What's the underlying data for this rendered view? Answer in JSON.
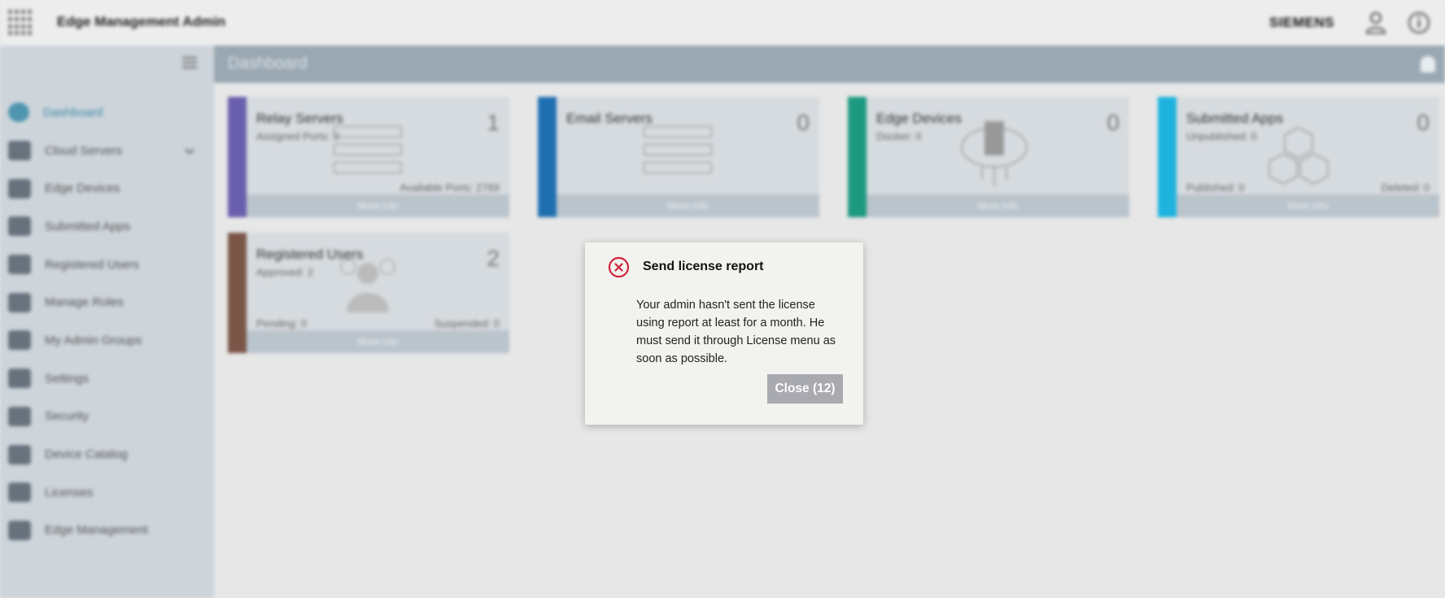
{
  "topbar": {
    "app_title": "Edge Management Admin",
    "brand": "SIEMENS"
  },
  "header": {
    "page_title": "Dashboard"
  },
  "sidebar": {
    "items": [
      {
        "label": "Dashboard",
        "icon": "dashboard-icon",
        "active": true
      },
      {
        "label": "Cloud Servers",
        "icon": "server-icon",
        "expandable": true
      },
      {
        "label": "Edge Devices",
        "icon": "device-icon"
      },
      {
        "label": "Submitted Apps",
        "icon": "apps-icon"
      },
      {
        "label": "Registered Users",
        "icon": "users-icon"
      },
      {
        "label": "Manage Roles",
        "icon": "roles-icon"
      },
      {
        "label": "My Admin Groups",
        "icon": "user-icon"
      },
      {
        "label": "Settings",
        "icon": "gear-icon"
      },
      {
        "label": "Security",
        "icon": "security-icon"
      },
      {
        "label": "Device Catalog",
        "icon": "catalog-icon"
      },
      {
        "label": "Licenses",
        "icon": "license-icon"
      },
      {
        "label": "Edge Management",
        "icon": "edge-management-icon"
      }
    ]
  },
  "cards": [
    {
      "title": "Relay Servers",
      "count": "1",
      "sub": "Assigned Ports: 0",
      "bottom_left": "",
      "bottom_right": "Available Ports: 2769",
      "footer": "More info",
      "color": "#6a5fae"
    },
    {
      "title": "Email Servers",
      "count": "0",
      "sub": "",
      "bottom_left": "",
      "bottom_right": "",
      "footer": "More info",
      "color": "#1f6fb0"
    },
    {
      "title": "Edge Devices",
      "count": "0",
      "sub": "Docker: 0",
      "bottom_left": "",
      "bottom_right": "",
      "footer": "More info",
      "color": "#1d9980"
    },
    {
      "title": "Submitted Apps",
      "count": "0",
      "sub": "Unpublished: 0",
      "bottom_left": "Published: 0",
      "bottom_right": "Deleted: 0",
      "footer": "More info",
      "color": "#1cb3de"
    },
    {
      "title": "Registered Users",
      "count": "2",
      "sub": "Approved: 2",
      "bottom_left": "Pending: 0",
      "bottom_right": "Suspended: 0",
      "footer": "More info",
      "color": "#7a5548"
    }
  ],
  "dialog": {
    "title": "Send license report",
    "message": "Your admin hasn't sent the license using report at least for a month. He must send it through License menu as soon as possible.",
    "close_label": "Close (12)",
    "error_color": "#d0223c"
  }
}
